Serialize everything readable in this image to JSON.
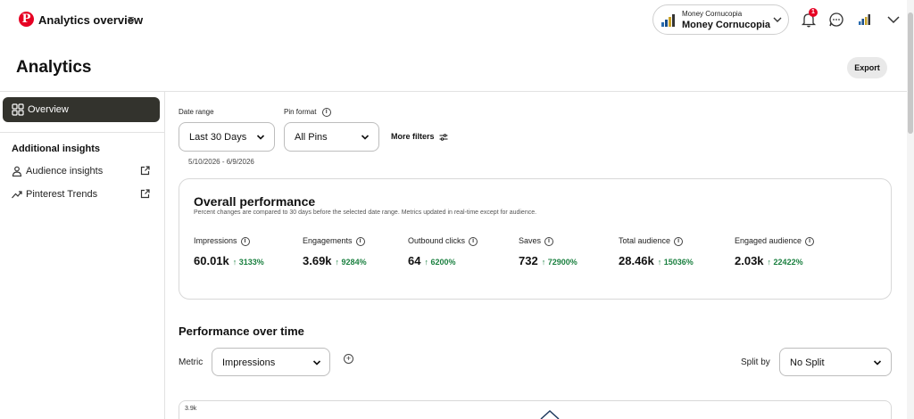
{
  "topbar": {
    "logo_letter": "P",
    "title": "Analytics overview",
    "menu_glyph": "≡",
    "account": {
      "label_small": "Money Cornucopia",
      "label_big": "Money Cornucopia"
    },
    "notifications_count": "1"
  },
  "header": {
    "title": "Analytics",
    "export_label": "Export"
  },
  "sidebar": {
    "overview_label": "Overview",
    "section_heading": "Additional insights",
    "items": [
      {
        "label": "Audience insights",
        "icon": "person-icon"
      },
      {
        "label": "Pinterest Trends",
        "icon": "trend-icon"
      }
    ]
  },
  "filters": {
    "date_range_label": "Date range",
    "date_range_value": "Last 30 Days",
    "date_range_dates": "5/10/2026 - 6/9/2026",
    "pin_format_label": "Pin format",
    "pin_format_value": "All Pins",
    "more_filters_label": "More filters"
  },
  "performance": {
    "title": "Overall performance",
    "subtitle": "Percent changes are compared to 30 days before the selected date range. Metrics updated in real-time except for audience.",
    "metrics": [
      {
        "label": "Impressions",
        "value": "60.01k",
        "change": "↑ 3133%"
      },
      {
        "label": "Engagements",
        "value": "3.69k",
        "change": "↑ 9284%"
      },
      {
        "label": "Outbound clicks",
        "value": "64",
        "change": "↑ 6200%"
      },
      {
        "label": "Saves",
        "value": "732",
        "change": "↑ 72900%"
      },
      {
        "label": "Total audience",
        "value": "28.46k",
        "change": "↑ 15036%"
      },
      {
        "label": "Engaged audience",
        "value": "2.03k",
        "change": "↑ 22422%"
      }
    ]
  },
  "over_time": {
    "title": "Performance over time",
    "metric_label": "Metric",
    "metric_value": "Impressions",
    "split_label": "Split by",
    "split_value": "No Split",
    "chart_tick": "3.9k"
  },
  "colors": {
    "brand": "#e60023",
    "positive": "#1b8040",
    "nav_active": "#33332d"
  }
}
